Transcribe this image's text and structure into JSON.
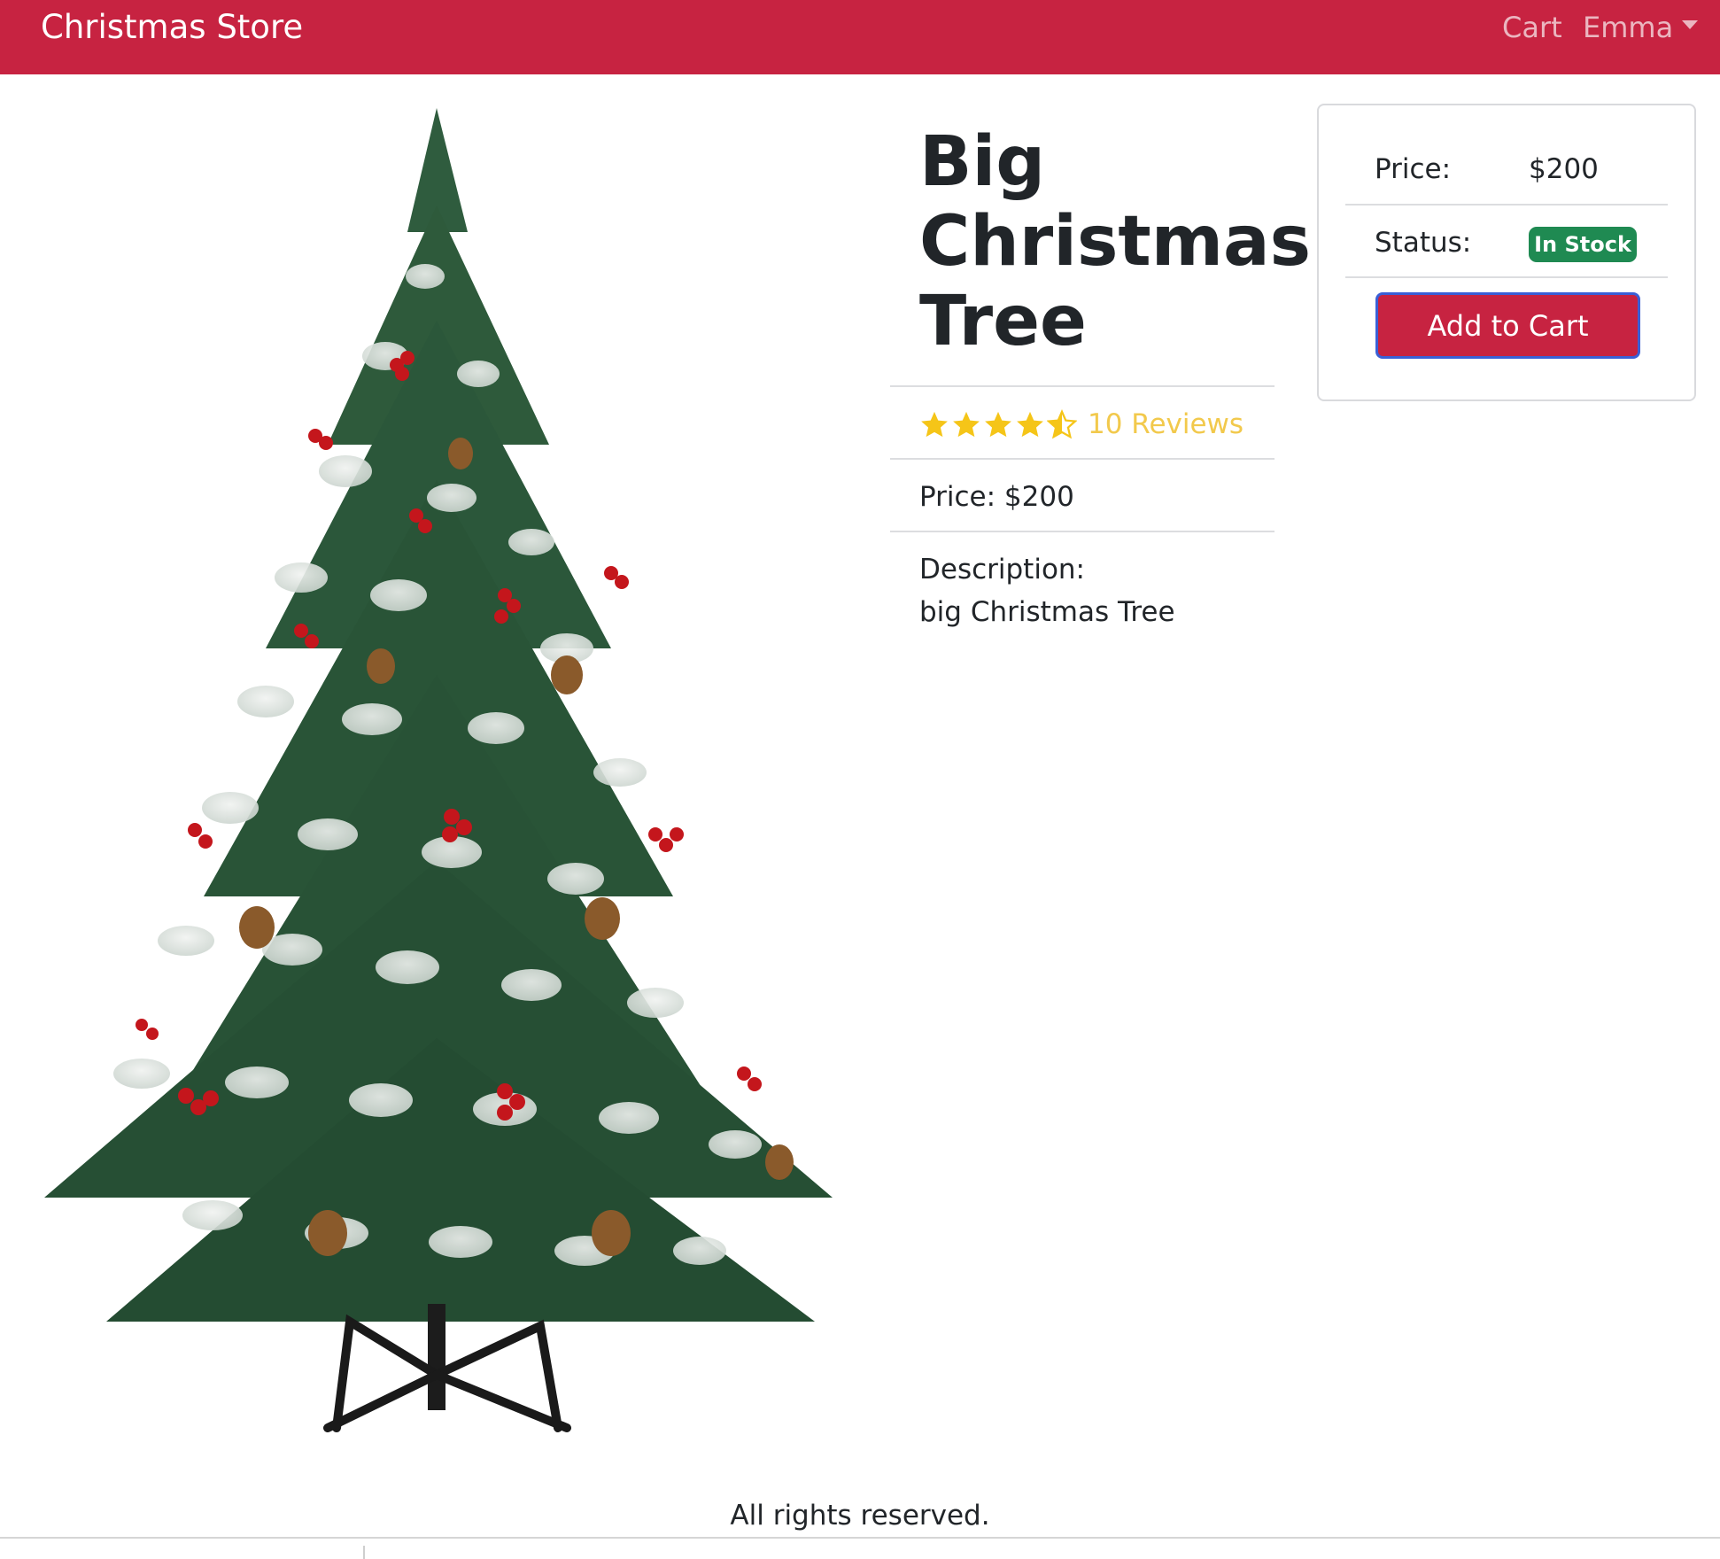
{
  "navbar": {
    "brand": "Christmas Store",
    "cart_label": "Cart",
    "user_label": "Emma",
    "background": "#c72341"
  },
  "product": {
    "image_alt": "Big Christmas Tree",
    "name": "Big Christmas Tree",
    "rating": 4.5,
    "rating_max": 5,
    "reviews_text": "10 Reviews",
    "price_line": "Price: $200",
    "description_label": "Description:",
    "description": "big Christmas Tree"
  },
  "purchase_card": {
    "price_label": "Price:",
    "price_value": "$200",
    "status_label": "Status:",
    "status_value": "In Stock",
    "status_color": "#1f8a52",
    "add_to_cart_label": "Add to Cart",
    "button_color": "#c72341"
  },
  "footer": {
    "text": "All rights reserved."
  }
}
